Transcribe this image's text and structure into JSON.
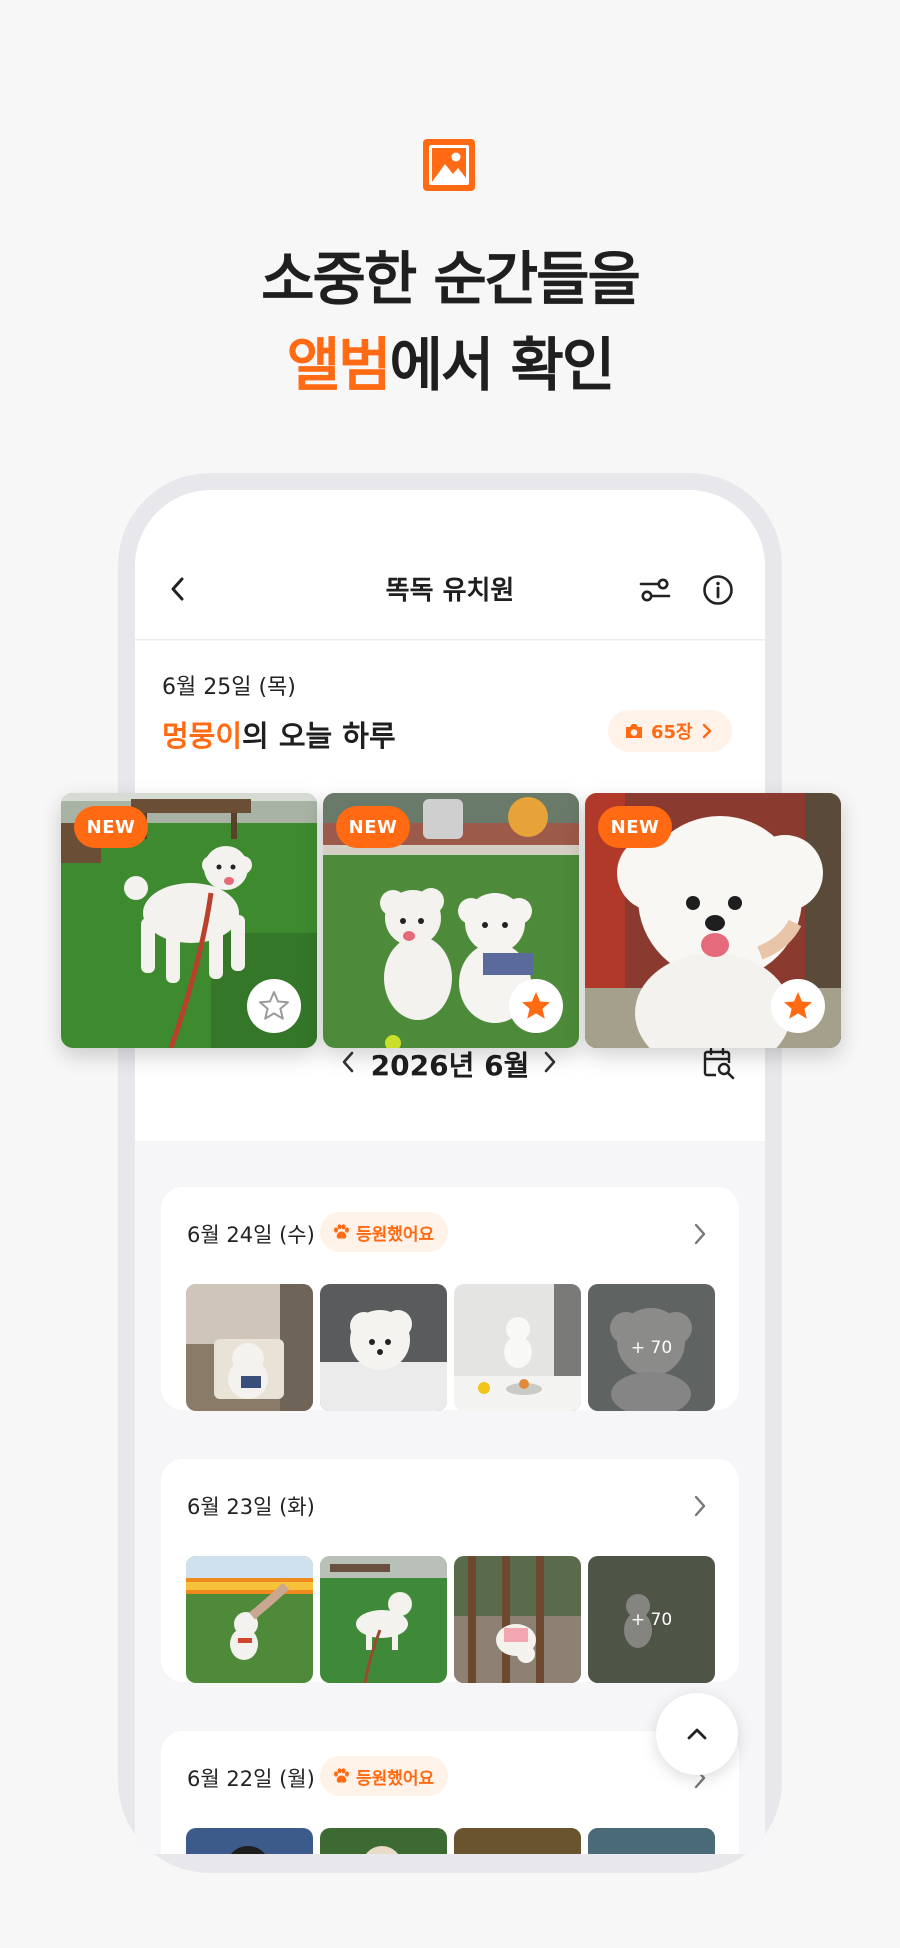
{
  "hero": {
    "icon": "image-icon",
    "line1": "소중한 순간들을",
    "line2_accent": "앨범",
    "line2_rest": "에서 확인"
  },
  "header": {
    "title": "똑독 유치원",
    "back_icon": "chevron-left-icon",
    "filter_icon": "filter-icon",
    "info_icon": "info-icon"
  },
  "today": {
    "date": "6월 25일 (목)",
    "pet_name": "멍뭉이",
    "title_rest": "의 오늘 하루",
    "photo_count": "65장"
  },
  "featured": [
    {
      "badge": "NEW",
      "favorited": false
    },
    {
      "badge": "NEW",
      "favorited": true
    },
    {
      "badge": "NEW",
      "favorited": true
    }
  ],
  "month": {
    "label": "2026년 6월"
  },
  "days": [
    {
      "date": "6월 24일 (수)",
      "badge": "등원했어요",
      "more": "+ 70"
    },
    {
      "date": "6월 23일 (화)",
      "badge": "",
      "more": "+ 70"
    },
    {
      "date": "6월 22일 (월)",
      "badge": "등원했어요",
      "more": ""
    }
  ],
  "colors": {
    "accent": "#ff6a13",
    "accent_soft": "#fff2e8",
    "background": "#f7f7f7"
  }
}
